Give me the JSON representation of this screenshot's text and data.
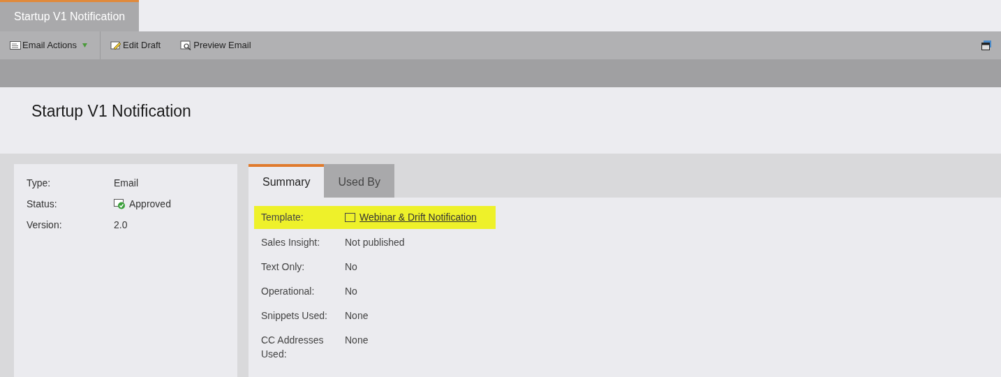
{
  "window_tab": {
    "title": "Startup V1 Notification",
    "selected": true
  },
  "toolbar": [
    {
      "label": "Email Actions",
      "kind": "menu"
    },
    {
      "label": "Edit Draft",
      "kind": "edit"
    },
    {
      "label": "Preview Email",
      "kind": "preview"
    }
  ],
  "page_title": "Startup V1 Notification",
  "details": [
    {
      "label": "Type:",
      "value": "Email",
      "kind": "text"
    },
    {
      "label": "Status:",
      "value": "Approved",
      "kind": "status"
    },
    {
      "label": "Version:",
      "value": "2.0",
      "kind": "text"
    }
  ],
  "tabs": [
    {
      "label": "Summary",
      "selected": true
    },
    {
      "label": "Used By",
      "selected": false
    }
  ],
  "summary": [
    {
      "label": "Template:",
      "value": "Webinar & Drift Notification",
      "kind": "link",
      "highlighted": true
    },
    {
      "label": "Sales Insight:",
      "value": "Not published",
      "kind": "text",
      "highlighted": false
    },
    {
      "label": "Text Only:",
      "value": "No",
      "kind": "text",
      "highlighted": false
    },
    {
      "label": "Operational:",
      "value": "No",
      "kind": "text",
      "highlighted": false
    },
    {
      "label": "Snippets Used:",
      "value": "None",
      "kind": "text",
      "highlighted": false
    },
    {
      "label": "CC Addresses Used:",
      "value": "None",
      "kind": "text",
      "highlighted": false
    }
  ]
}
